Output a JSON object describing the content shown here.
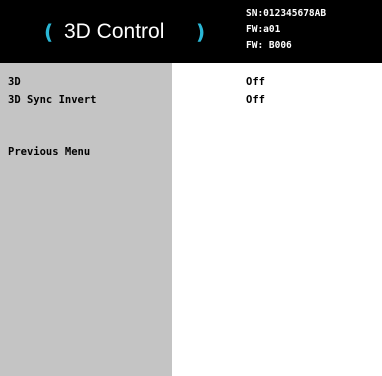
{
  "colors": {
    "header_bg": "#000000",
    "bracket_accent": "#2ab7d6",
    "sidebar_bg": "#c4c4c4",
    "content_bg": "#ffffff",
    "text": "#000000",
    "header_text": "#ffffff"
  },
  "header": {
    "bracket_open": "(",
    "title": "3D Control",
    "bracket_close": ")",
    "serial": "SN:012345678AB",
    "firmware": "FW:a01",
    "firmware_b": "FW: B006"
  },
  "menu": {
    "items": [
      {
        "label": "3D",
        "value": "Off"
      },
      {
        "label": "3D Sync Invert",
        "value": "Off"
      }
    ],
    "previous_menu": "Previous Menu"
  }
}
